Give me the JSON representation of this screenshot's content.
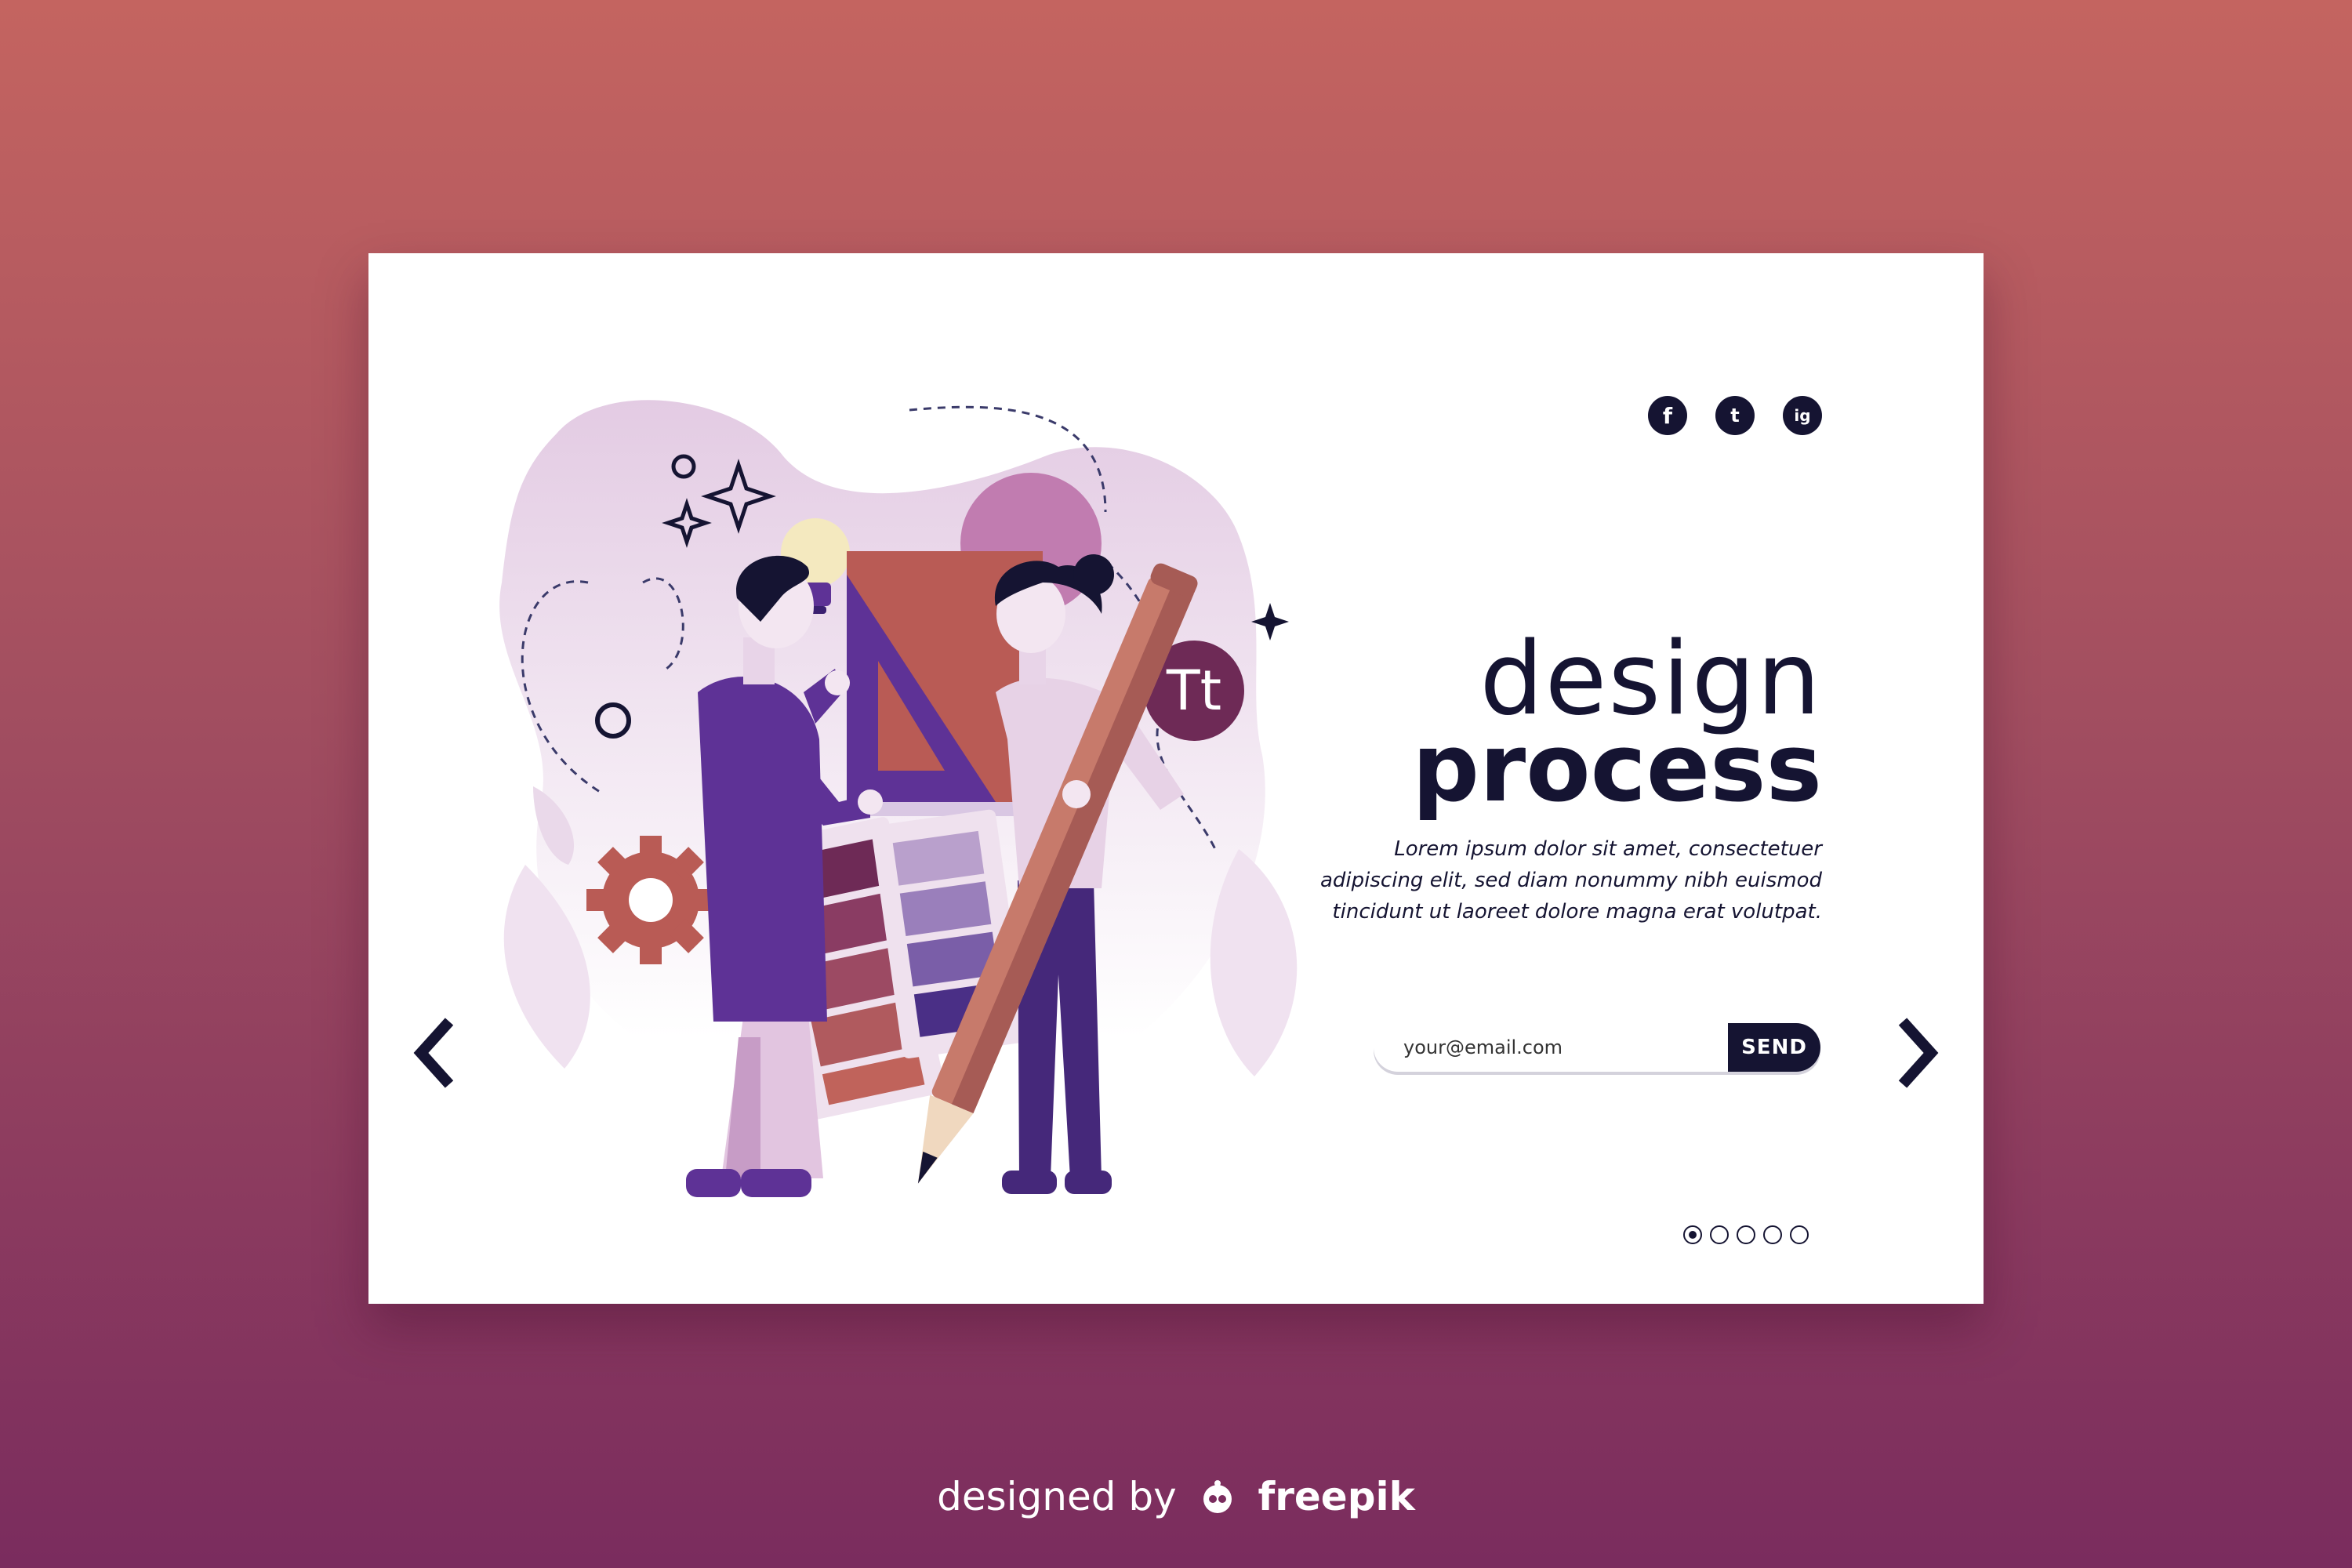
{
  "social": {
    "facebook_icon": "f",
    "twitter_icon": "t",
    "instagram_icon": "ig"
  },
  "hero": {
    "title_line1": "design",
    "title_line2": "process",
    "description": "Lorem ipsum dolor sit amet, consectetuer adipiscing elit, sed diam nonummy nibh euismod tincidunt ut laoreet dolore magna erat volutpat.",
    "badge": "Tt"
  },
  "subscribe": {
    "placeholder": "your@email.com",
    "button_label": "SEND"
  },
  "pagination": {
    "pages": 5,
    "active": 1
  },
  "credit": {
    "prefix": "designed by",
    "brand": "freepik"
  },
  "colors": {
    "ink": "#151432",
    "bg_top": "#c46460",
    "bg_bottom": "#7a2c5e",
    "purple": "#5e3296",
    "rust": "#b95b55",
    "lavender": "#e7d2e6"
  }
}
